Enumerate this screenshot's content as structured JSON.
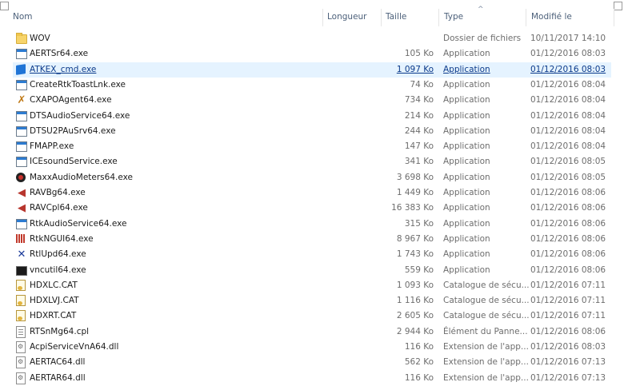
{
  "columns": {
    "name": "Nom",
    "length": "Longueur",
    "size": "Taille",
    "type": "Type",
    "modified": "Modifié le"
  },
  "sort": {
    "column": "type",
    "direction": "ascending"
  },
  "rows": [
    {
      "name": "WOV",
      "size": "",
      "type": "Dossier de fichiers",
      "date": "10/11/2017 14:10",
      "icon": "folder-icon",
      "selected": false
    },
    {
      "name": "AERTSr64.exe",
      "size": "105 Ko",
      "type": "Application",
      "date": "01/12/2016 08:03",
      "icon": "application-icon",
      "selected": false
    },
    {
      "name": "ATKEX_cmd.exe",
      "size": "1 097 Ko",
      "type": "Application",
      "date": "01/12/2016 08:03",
      "icon": "blue-cube-icon",
      "selected": true
    },
    {
      "name": "CreateRtkToastLnk.exe",
      "size": "74 Ko",
      "type": "Application",
      "date": "01/12/2016 08:04",
      "icon": "application-icon",
      "selected": false
    },
    {
      "name": "CXAPOAgent64.exe",
      "size": "734 Ko",
      "type": "Application",
      "date": "01/12/2016 08:04",
      "icon": "tools-icon",
      "selected": false
    },
    {
      "name": "DTSAudioService64.exe",
      "size": "214 Ko",
      "type": "Application",
      "date": "01/12/2016 08:04",
      "icon": "application-icon",
      "selected": false
    },
    {
      "name": "DTSU2PAuSrv64.exe",
      "size": "244 Ko",
      "type": "Application",
      "date": "01/12/2016 08:04",
      "icon": "application-icon",
      "selected": false
    },
    {
      "name": "FMAPP.exe",
      "size": "147 Ko",
      "type": "Application",
      "date": "01/12/2016 08:04",
      "icon": "application-icon",
      "selected": false
    },
    {
      "name": "ICEsoundService.exe",
      "size": "341 Ko",
      "type": "Application",
      "date": "01/12/2016 08:05",
      "icon": "application-icon",
      "selected": false
    },
    {
      "name": "MaxxAudioMeters64.exe",
      "size": "3 698 Ko",
      "type": "Application",
      "date": "01/12/2016 08:05",
      "icon": "gauge-icon",
      "selected": false
    },
    {
      "name": "RAVBg64.exe",
      "size": "1 449 Ko",
      "type": "Application",
      "date": "01/12/2016 08:06",
      "icon": "speaker-icon",
      "selected": false
    },
    {
      "name": "RAVCpl64.exe",
      "size": "16 383 Ko",
      "type": "Application",
      "date": "01/12/2016 08:06",
      "icon": "speaker-icon",
      "selected": false
    },
    {
      "name": "RtkAudioService64.exe",
      "size": "315 Ko",
      "type": "Application",
      "date": "01/12/2016 08:06",
      "icon": "application-icon",
      "selected": false
    },
    {
      "name": "RtkNGUI64.exe",
      "size": "8 967 Ko",
      "type": "Application",
      "date": "01/12/2016 08:06",
      "icon": "audio-bars-icon",
      "selected": false
    },
    {
      "name": "RtlUpd64.exe",
      "size": "1 743 Ko",
      "type": "Application",
      "date": "01/12/2016 08:06",
      "icon": "realtek-update-icon",
      "selected": false
    },
    {
      "name": "vncutil64.exe",
      "size": "559 Ko",
      "type": "Application",
      "date": "01/12/2016 08:06",
      "icon": "console-icon",
      "selected": false
    },
    {
      "name": "HDXLC.CAT",
      "size": "1 093 Ko",
      "type": "Catalogue de sécu...",
      "date": "01/12/2016 07:11",
      "icon": "certificate-icon",
      "selected": false
    },
    {
      "name": "HDXLVJ.CAT",
      "size": "1 116 Ko",
      "type": "Catalogue de sécu...",
      "date": "01/12/2016 07:11",
      "icon": "certificate-icon",
      "selected": false
    },
    {
      "name": "HDXRT.CAT",
      "size": "2 605 Ko",
      "type": "Catalogue de sécu...",
      "date": "01/12/2016 07:11",
      "icon": "certificate-icon",
      "selected": false
    },
    {
      "name": "RTSnMg64.cpl",
      "size": "2 944 Ko",
      "type": "Élément du Panne...",
      "date": "01/12/2016 08:06",
      "icon": "document-icon",
      "selected": false
    },
    {
      "name": "AcpiServiceVnA64.dll",
      "size": "116 Ko",
      "type": "Extension de l'app...",
      "date": "01/12/2016 08:03",
      "icon": "dll-icon",
      "selected": false
    },
    {
      "name": "AERTAC64.dll",
      "size": "562 Ko",
      "type": "Extension de l'app...",
      "date": "01/12/2016 07:13",
      "icon": "dll-icon",
      "selected": false
    },
    {
      "name": "AERTAR64.dll",
      "size": "116 Ko",
      "type": "Extension de l'app...",
      "date": "01/12/2016 07:13",
      "icon": "dll-icon",
      "selected": false
    }
  ]
}
